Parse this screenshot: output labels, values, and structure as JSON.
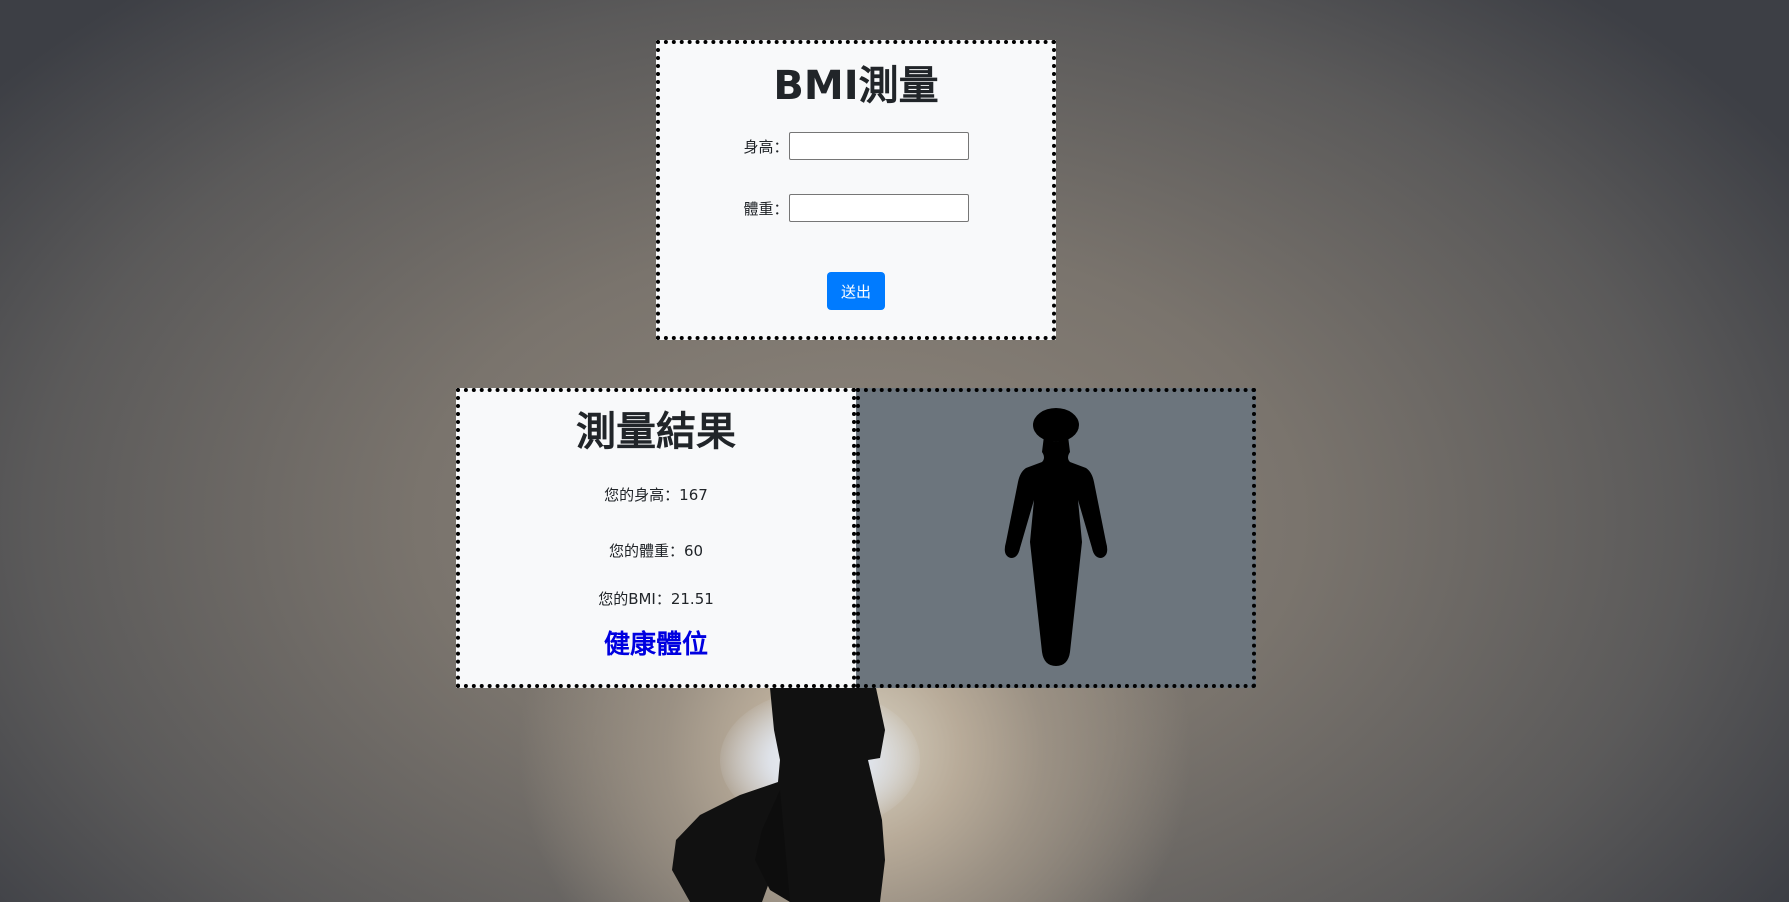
{
  "form": {
    "title": "BMI測量",
    "height_label": "身高：",
    "height_value": "",
    "weight_label": "體重：",
    "weight_value": "",
    "submit_label": "送出"
  },
  "result": {
    "title": "測量結果",
    "height_text": "您的身高：167",
    "weight_text": "您的體重：60",
    "bmi_text": "您的BMI：21.51",
    "status_text": "健康體位",
    "status_color": "#0000e0"
  },
  "figure": {
    "icon": "body-silhouette-icon"
  }
}
